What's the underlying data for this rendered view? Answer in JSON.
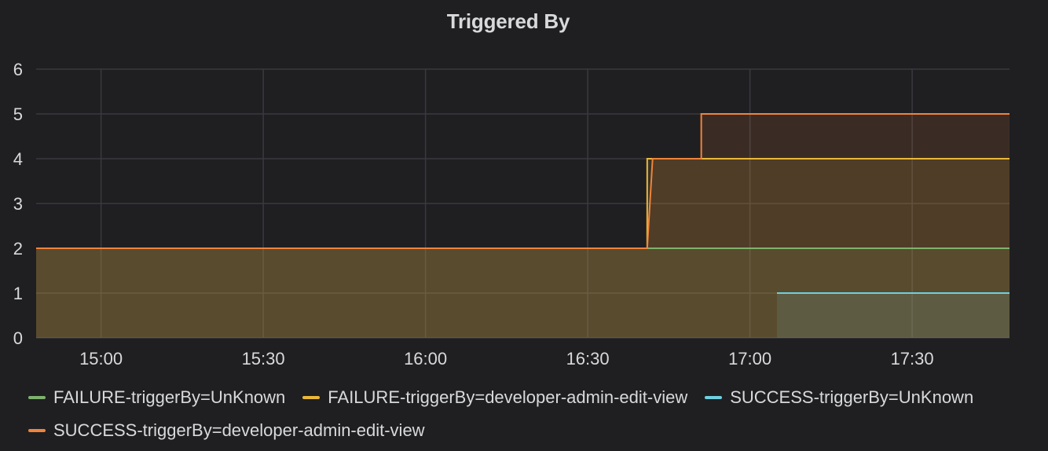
{
  "chart_data": {
    "type": "area",
    "title": "Triggered By",
    "xlabel": "",
    "ylabel": "",
    "x_ticks": [
      "15:00",
      "15:30",
      "16:00",
      "16:30",
      "17:00",
      "17:30"
    ],
    "y_ticks": [
      "0",
      "1",
      "2",
      "3",
      "4",
      "5",
      "6"
    ],
    "xlim": [
      "14:48",
      "17:48"
    ],
    "ylim": [
      0,
      6
    ],
    "grid": true,
    "legend_position": "bottom",
    "series": [
      {
        "name": "FAILURE-triggerBy=UnKnown",
        "color": "#7eb26d",
        "x": [
          "14:48",
          "17:48"
        ],
        "values": [
          2,
          2
        ]
      },
      {
        "name": "FAILURE-triggerBy=developer-admin-edit-view",
        "color": "#eab839",
        "x": [
          "14:48",
          "16:41",
          "16:41",
          "17:48"
        ],
        "values": [
          2,
          2,
          4,
          4
        ]
      },
      {
        "name": "SUCCESS-triggerBy=UnKnown",
        "color": "#6ed0e0",
        "x": [
          "17:05",
          "17:48"
        ],
        "values": [
          1,
          1
        ]
      },
      {
        "name": "SUCCESS-triggerBy=developer-admin-edit-view",
        "color": "#ef843c",
        "x": [
          "14:48",
          "16:41",
          "16:42",
          "16:51",
          "16:51",
          "17:48"
        ],
        "values": [
          2,
          2,
          4,
          4,
          5,
          5
        ]
      }
    ]
  }
}
